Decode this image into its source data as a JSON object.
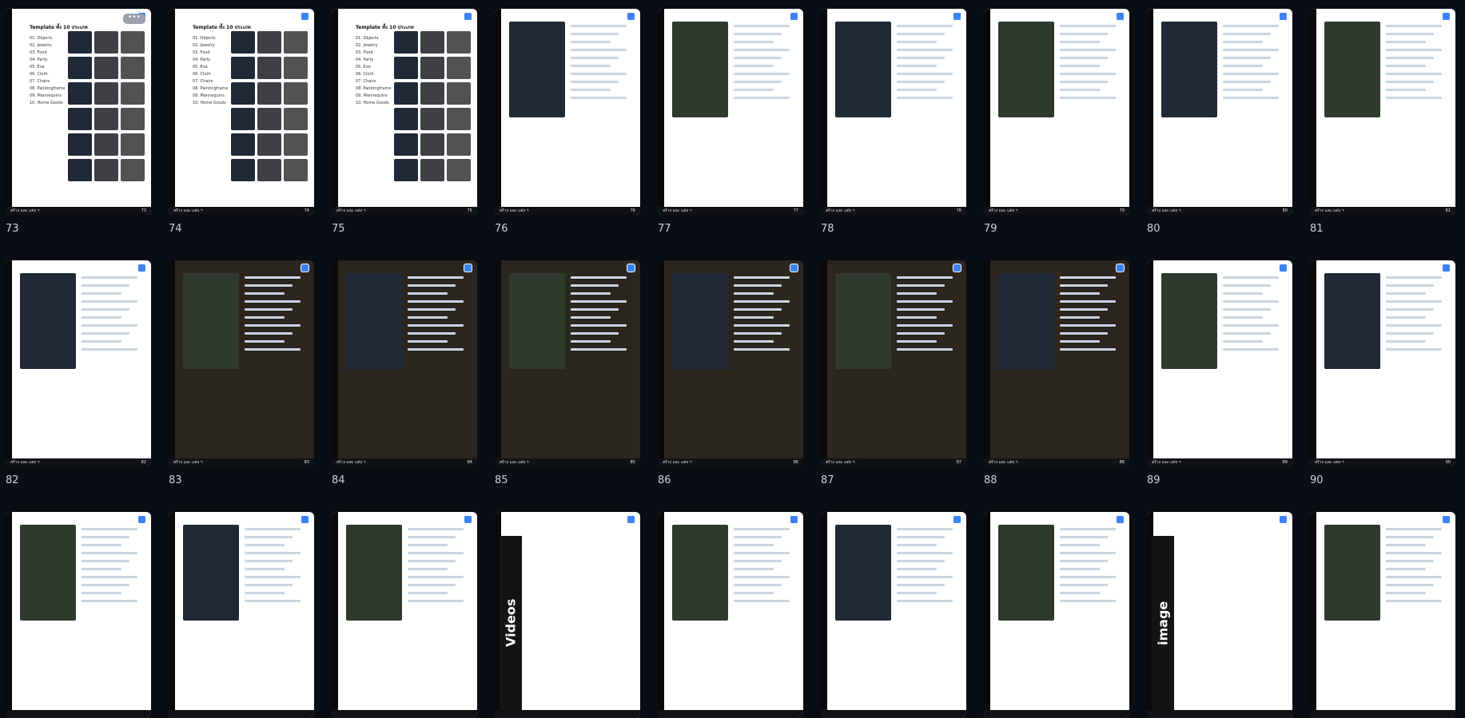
{
  "slides": [
    {
      "label": "73",
      "title": "Template ทั้ง 10 ประเภท",
      "items": [
        "01. Objects",
        "02. Jewelry",
        "03. Food",
        "04. Party",
        "05. Eve",
        "06. Cloth",
        "07. Chairs",
        "08. Paintingframe",
        "09. Mannequins",
        "10. Home Goods"
      ],
      "menu_label": "•••",
      "footer_left": "สร้าง และ แต่ง ฯ",
      "footer_right": "73"
    },
    {
      "label": "74",
      "title": "Template ทั้ง 10 ประเภท",
      "items": [
        "01. Objects",
        "02. Jewelry",
        "03. Food",
        "04. Party",
        "05. Eve",
        "06. Cloth",
        "07. Chairs",
        "08. Paintingframe",
        "09. Mannequins",
        "10. Home Goods"
      ],
      "footer_left": "สร้าง และ แต่ง ฯ",
      "footer_right": "74"
    },
    {
      "label": "75",
      "title": "Template ทั้ง 10 ประเภท",
      "items": [
        "01. Objects",
        "02. Jewelry",
        "03. Food",
        "04. Party",
        "05. Eve",
        "06. Cloth",
        "07. Chairs",
        "08. Paintingframe",
        "09. Mannequins",
        "10. Home Goods"
      ],
      "footer_left": "สร้าง และ แต่ง ฯ",
      "footer_right": "75"
    },
    {
      "label": "76",
      "footer_left": "สร้าง และ แต่ง ฯ",
      "footer_right": "76"
    },
    {
      "label": "77",
      "footer_left": "สร้าง และ แต่ง ฯ",
      "footer_right": "77"
    },
    {
      "label": "78",
      "footer_left": "สร้าง และ แต่ง ฯ",
      "footer_right": "78"
    },
    {
      "label": "79",
      "footer_left": "สร้าง และ แต่ง ฯ",
      "footer_right": "79"
    },
    {
      "label": "80",
      "footer_left": "สร้าง และ แต่ง ฯ",
      "footer_right": "80"
    },
    {
      "label": "81",
      "footer_left": "สร้าง และ แต่ง ฯ",
      "footer_right": "81"
    },
    {
      "label": "82",
      "footer_left": "สร้าง และ แต่ง ฯ",
      "footer_right": "82"
    },
    {
      "label": "83",
      "footer_left": "สร้าง และ แต่ง ฯ",
      "footer_right": "83"
    },
    {
      "label": "84",
      "footer_left": "สร้าง และ แต่ง ฯ",
      "footer_right": "84"
    },
    {
      "label": "85",
      "footer_left": "สร้าง และ แต่ง ฯ",
      "footer_right": "85"
    },
    {
      "label": "86",
      "footer_left": "สร้าง และ แต่ง ฯ",
      "footer_right": "86"
    },
    {
      "label": "87",
      "footer_left": "สร้าง และ แต่ง ฯ",
      "footer_right": "87"
    },
    {
      "label": "88",
      "footer_left": "สร้าง และ แต่ง ฯ",
      "footer_right": "88"
    },
    {
      "label": "89",
      "footer_left": "สร้าง และ แต่ง ฯ",
      "footer_right": "89"
    },
    {
      "label": "90",
      "footer_left": "สร้าง และ แต่ง ฯ",
      "footer_right": "90"
    },
    {
      "label": "",
      "footer_left": "",
      "footer_right": ""
    },
    {
      "label": "",
      "footer_left": "",
      "footer_right": ""
    },
    {
      "label": "",
      "footer_left": "",
      "footer_right": ""
    },
    {
      "label": "",
      "vertical": "Videos",
      "footer_left": "",
      "footer_right": ""
    },
    {
      "label": "",
      "footer_left": "",
      "footer_right": ""
    },
    {
      "label": "",
      "footer_left": "",
      "footer_right": ""
    },
    {
      "label": "",
      "footer_left": "",
      "footer_right": ""
    },
    {
      "label": "",
      "vertical": "image",
      "footer_left": "",
      "footer_right": ""
    },
    {
      "label": "",
      "footer_left": "",
      "footer_right": ""
    }
  ],
  "icons": {
    "badge": "cloud-badge-icon",
    "menu": "more-options-icon"
  },
  "colors": {
    "background": "#0b0d14",
    "badge": "#3b82f6"
  }
}
